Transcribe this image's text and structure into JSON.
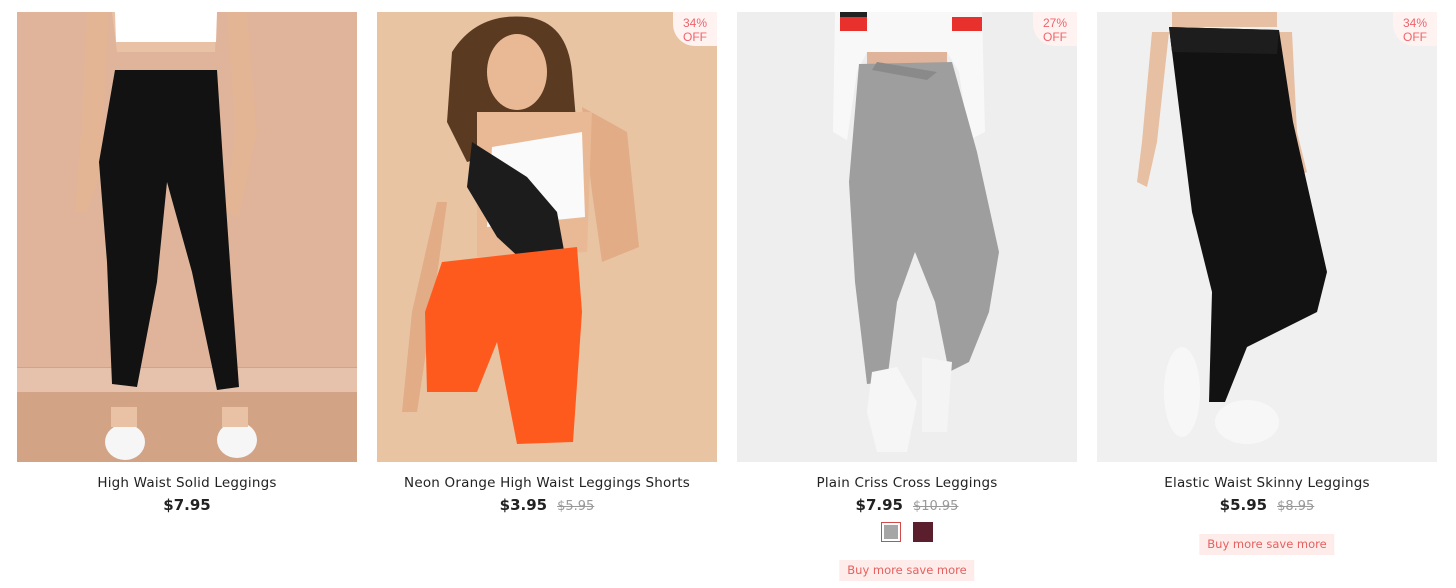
{
  "products": [
    {
      "name": "High Waist Solid Leggings",
      "price": "$7.95",
      "image_background": "#dfb49a"
    },
    {
      "name": "Neon Orange High Waist Leggings Shorts",
      "price": "$3.95",
      "original_price": "$5.95",
      "discount_percent": "34%",
      "discount_off": "OFF",
      "image_background": "#e8c4a3"
    },
    {
      "name": "Plain Criss Cross Leggings",
      "price": "$7.95",
      "original_price": "$10.95",
      "discount_percent": "27%",
      "discount_off": "OFF",
      "color_swatches": [
        "#a6a6a6",
        "#5a1e2c"
      ],
      "selected_swatch": 0,
      "promo_label": "Buy more save more",
      "image_background": "#eeeeee"
    },
    {
      "name": "Elastic Waist Skinny Leggings",
      "price": "$5.95",
      "original_price": "$8.95",
      "discount_percent": "34%",
      "discount_off": "OFF",
      "promo_label": "Buy more save more",
      "image_background": "#f0f0f0"
    }
  ],
  "colors": {
    "badge_text": "#f0636b",
    "badge_background": "#fff3f1",
    "promo_text": "#e8605e",
    "promo_background": "#fdecea",
    "price_text": "#222222",
    "old_price_text": "#999999"
  }
}
